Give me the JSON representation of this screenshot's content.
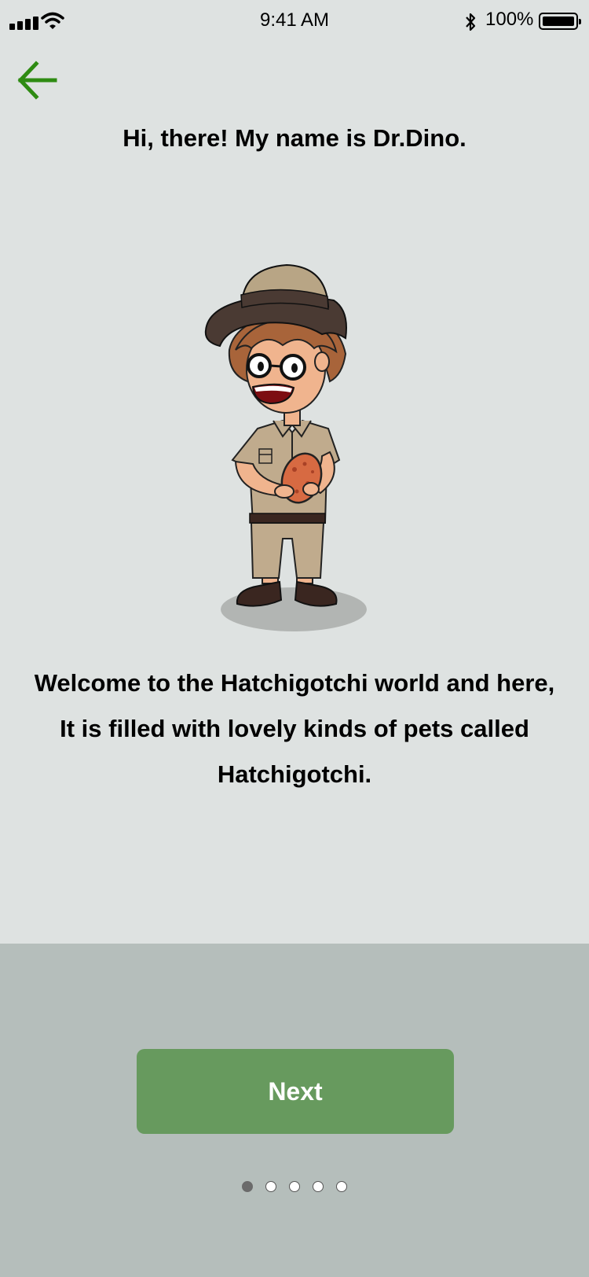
{
  "status_bar": {
    "time": "9:41 AM",
    "battery_percent": "100%",
    "icons": [
      "signal-icon",
      "wifi-icon",
      "bluetooth-icon",
      "battery-icon"
    ]
  },
  "header": {
    "back_icon": "arrow-left-icon",
    "title": "Hi, there! My name is Dr.Dino."
  },
  "illustration": {
    "name": "dr-dino-character"
  },
  "welcome_lines": [
    "Welcome to the Hatchigotchi world and here,",
    "It is filled with lovely kinds of pets called",
    "Hatchigotchi."
  ],
  "footer": {
    "next_label": "Next",
    "page_indicator": {
      "total": 5,
      "current": 1
    }
  },
  "colors": {
    "accent": "#2e8b12",
    "button": "#679a5e",
    "background": "#dee2e1",
    "panel": "#b5bebb"
  }
}
